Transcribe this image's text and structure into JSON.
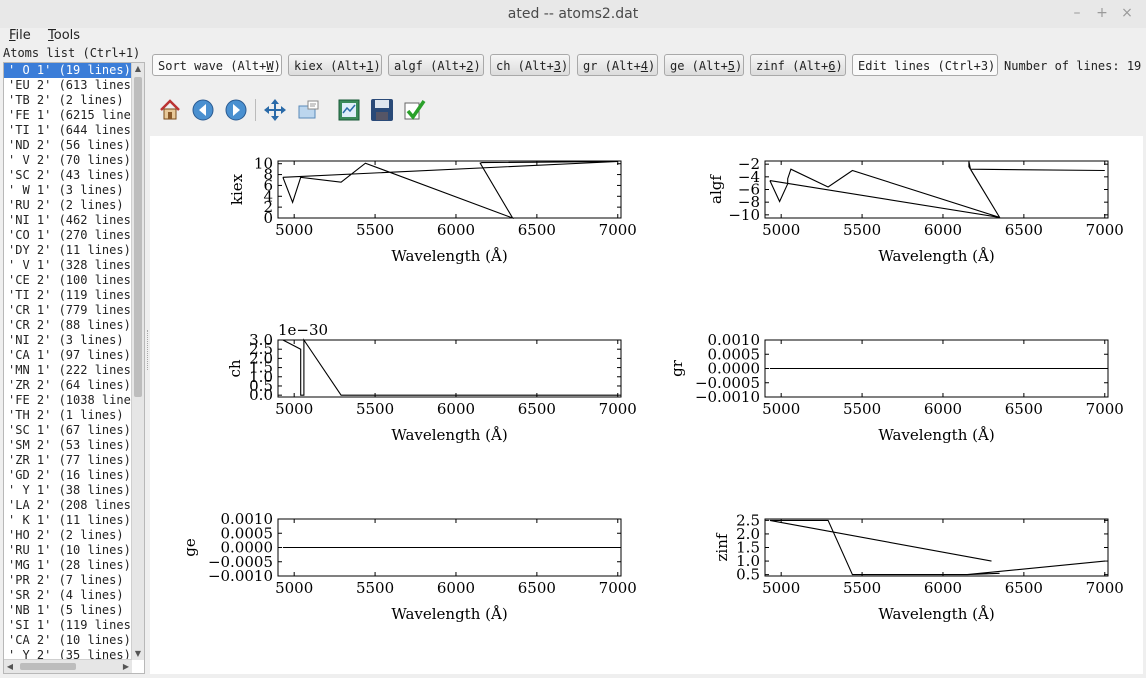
{
  "window": {
    "title": "ated -- atoms2.dat"
  },
  "menu": [
    {
      "label": "File",
      "mnemonic": "F",
      "rest": "ile"
    },
    {
      "label": "Tools",
      "mnemonic": "T",
      "rest": "ools"
    }
  ],
  "atoms_list": {
    "label": "Atoms list (Ctrl+1)",
    "selected_index": 0,
    "items": [
      "' O 1' (19 lines)",
      "'EU 2' (613 lines",
      "'TB 2' (2 lines)",
      "'FE 1' (6215 line",
      "'TI 1' (644 lines",
      "'ND 2' (56 lines)",
      "' V 2' (70 lines)",
      "'SC 2' (43 lines)",
      "' W 1' (3 lines)",
      "'RU 2' (2 lines)",
      "'NI 1' (462 lines",
      "'CO 1' (270 lines",
      "'DY 2' (11 lines)",
      "' V 1' (328 lines",
      "'CE 2' (100 lines",
      "'TI 2' (119 lines",
      "'CR 1' (779 lines",
      "'CR 2' (88 lines)",
      "'NI 2' (3 lines)",
      "'CA 1' (97 lines)",
      "'MN 1' (222 lines",
      "'ZR 2' (64 lines)",
      "'FE 2' (1038 line",
      "'TH 2' (1 lines)",
      "'SC 1' (67 lines)",
      "'SM 2' (53 lines)",
      "'ZR 1' (77 lines)",
      "'GD 2' (16 lines)",
      "' Y 1' (38 lines)",
      "'LA 2' (208 lines",
      "' K 1' (11 lines)",
      "'HO 2' (2 lines)",
      "'RU 1' (10 lines)",
      "'MG 1' (28 lines)",
      "'PR 2' (7 lines)",
      "'SR 2' (4 lines)",
      "'NB 1' (5 lines)",
      "'SI 1' (119 lines",
      "'CA 2' (10 lines)",
      "' Y 2' (35 lines)"
    ]
  },
  "buttons": [
    {
      "pre": "Sort wave (Alt+",
      "key": "W",
      "post": ")"
    },
    {
      "pre": "kiex (Alt+",
      "key": "1",
      "post": ")"
    },
    {
      "pre": "algf (Alt+",
      "key": "2",
      "post": ")"
    },
    {
      "pre": "ch (Alt+",
      "key": "3",
      "post": ")"
    },
    {
      "pre": "gr (Alt+",
      "key": "4",
      "post": ")"
    },
    {
      "pre": "ge (Alt+",
      "key": "5",
      "post": ")"
    },
    {
      "pre": "zinf (Alt+",
      "key": "6",
      "post": ")"
    },
    {
      "pre": "Edit lines (Ctrl+3)",
      "key": "",
      "post": ""
    }
  ],
  "number_of_lines": "Number of lines: 19",
  "toolbar": [
    {
      "icon": "home-icon"
    },
    {
      "icon": "back-icon"
    },
    {
      "icon": "forward-icon"
    },
    {
      "icon": "pan-icon"
    },
    {
      "icon": "zoom-icon"
    },
    {
      "icon": "subplots-icon"
    },
    {
      "icon": "save-icon"
    },
    {
      "icon": "apply-icon"
    }
  ],
  "chart_data": [
    {
      "type": "line",
      "ylabel": "kiex",
      "xlabel": "Wavelength (Å)",
      "xlim": [
        4900,
        7020
      ],
      "ylim": [
        0,
        10.5
      ],
      "xticks": [
        5000,
        5500,
        6000,
        6500,
        7000
      ],
      "xtick_labels": [
        "5000",
        "5500",
        "6000",
        "6500",
        "7000"
      ],
      "yticks": [
        0,
        2,
        4,
        6,
        8,
        10
      ],
      "ytick_labels": [
        "0",
        "2",
        "4",
        "6",
        "8",
        "10"
      ],
      "x": [
        4930,
        4990,
        5040,
        5290,
        5440,
        6350,
        6150,
        6160,
        7000,
        4930
      ],
      "y": [
        7.5,
        2.9,
        7.5,
        6.6,
        10.1,
        0.0,
        10.1,
        10.2,
        10.4,
        7.5
      ]
    },
    {
      "type": "line",
      "ylabel": "algf",
      "xlabel": "Wavelength (Å)",
      "xlim": [
        4900,
        7020
      ],
      "ylim": [
        -10.5,
        -1.5
      ],
      "xticks": [
        5000,
        5500,
        6000,
        6500,
        7000
      ],
      "xtick_labels": [
        "5000",
        "5500",
        "6000",
        "6500",
        "7000"
      ],
      "yticks": [
        -2,
        -4,
        -6,
        -8,
        -10
      ],
      "ytick_labels": [
        "−2",
        "−4",
        "−6",
        "−8",
        "−10"
      ],
      "x": [
        4930,
        4990,
        5040,
        5040,
        5060,
        5290,
        5440,
        6350,
        6160,
        6160,
        6170,
        7000,
        6170,
        6350,
        4930
      ],
      "y": [
        -4.6,
        -7.9,
        -5.1,
        -4.3,
        -2.8,
        -5.6,
        -3.0,
        -10.4,
        -2.4,
        -1.6,
        -2.8,
        -3.0,
        -2.8,
        -10.4,
        -4.6
      ]
    },
    {
      "type": "line",
      "ylabel": "ch",
      "xlabel": "Wavelength (Å)",
      "offset_text": "1e−30",
      "xlim": [
        4900,
        7020
      ],
      "ylim": [
        -0.1,
        3.0
      ],
      "xticks": [
        5000,
        5500,
        6000,
        6500,
        7000
      ],
      "xtick_labels": [
        "5000",
        "5500",
        "6000",
        "6500",
        "7000"
      ],
      "yticks": [
        0.0,
        0.5,
        1.0,
        1.5,
        2.0,
        2.5,
        3.0
      ],
      "ytick_labels": [
        "0.0",
        "0.5",
        "1.0",
        "1.5",
        "2.0",
        "2.5",
        "3.0"
      ],
      "x": [
        4930,
        5040,
        5040,
        5060,
        5060,
        5290,
        6350,
        7000
      ],
      "y": [
        3.0,
        2.5,
        0.0,
        0.0,
        3.0,
        0.0,
        0.0,
        0.0
      ]
    },
    {
      "type": "line",
      "ylabel": "gr",
      "xlabel": "Wavelength (Å)",
      "xlim": [
        4900,
        7020
      ],
      "ylim": [
        -0.001,
        0.001
      ],
      "xticks": [
        5000,
        5500,
        6000,
        6500,
        7000
      ],
      "xtick_labels": [
        "5000",
        "5500",
        "6000",
        "6500",
        "7000"
      ],
      "yticks": [
        0.001,
        0.0005,
        0.0,
        -0.0005,
        -0.001
      ],
      "ytick_labels": [
        "0.0010",
        "0.0005",
        "0.0000",
        "−0.0005",
        "−0.0010"
      ],
      "x": [
        4930,
        7000
      ],
      "y": [
        0,
        0
      ]
    },
    {
      "type": "line",
      "ylabel": "ge",
      "xlabel": "Wavelength (Å)",
      "xlim": [
        4900,
        7020
      ],
      "ylim": [
        -0.001,
        0.001
      ],
      "xticks": [
        5000,
        5500,
        6000,
        6500,
        7000
      ],
      "xtick_labels": [
        "5000",
        "5500",
        "6000",
        "6500",
        "7000"
      ],
      "yticks": [
        0.001,
        0.0005,
        0.0,
        -0.0005,
        -0.001
      ],
      "ytick_labels": [
        "0.0010",
        "0.0005",
        "0.0000",
        "−0.0005",
        "−0.0010"
      ],
      "x": [
        4930,
        7000
      ],
      "y": [
        0,
        0
      ]
    },
    {
      "type": "line",
      "ylabel": "zinf",
      "xlabel": "Wavelength (Å)",
      "xlim": [
        4900,
        7020
      ],
      "ylim": [
        0.45,
        2.55
      ],
      "xticks": [
        5000,
        5500,
        6000,
        6500,
        7000
      ],
      "xtick_labels": [
        "5000",
        "5500",
        "6000",
        "6500",
        "7000"
      ],
      "yticks": [
        0.5,
        1.0,
        1.5,
        2.0,
        2.5
      ],
      "ytick_labels": [
        "0.5",
        "1.0",
        "1.5",
        "2.0",
        "2.5"
      ],
      "x": [
        6300,
        4930,
        5290,
        5440,
        6150,
        6350,
        6150,
        7000
      ],
      "y": [
        1.0,
        2.5,
        2.5,
        0.5,
        0.5,
        0.55,
        0.5,
        1.0
      ]
    }
  ]
}
